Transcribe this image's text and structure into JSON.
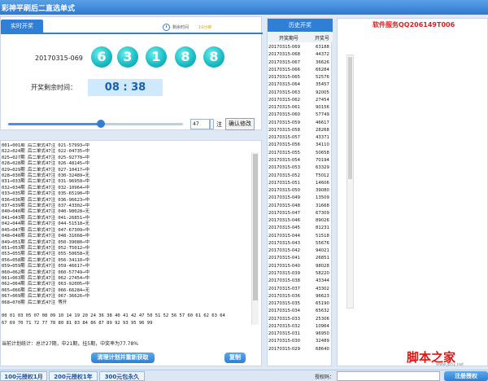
{
  "window": {
    "title": "彩神平刷后二直选单式"
  },
  "realtime": {
    "tab_label": "实时开奖",
    "remain_label": "剩余时间",
    "remain_value": "19分钟",
    "period": "20170315-069",
    "balls": [
      "6",
      "3",
      "1",
      "8",
      "8"
    ],
    "countdown_label": "开奖剩余时间：",
    "countdown": "08 : 38"
  },
  "controls": {
    "slider_fraction": 0.53,
    "count_value": "47",
    "unit": "注",
    "confirm_label": "确认修改"
  },
  "log": {
    "lines": [
      "001→001期 后二单式47注 021-57993→中",
      "022→024期 后二单式47注 022-04735→中",
      "025→027期 后二单式47注 025-92770→中",
      "028→028期 后二单式47注 026-48145→中",
      "029→029期 后二单式47注 027-10417→中",
      "028→030期 后二单式47注 030-32489→无",
      "031→033期 后二单式47注 031-96950→中",
      "032→034期 后二单式47注 032-10964→中",
      "033→035期 后二单式47注 035-65190→中",
      "036→036期 后二单式47注 036-96623→中",
      "037→039期 后二单式47注 037-43302→中",
      "040→040期 后二单式47注 040-98028→无",
      "041→043期 后二单式47注 041-26851→中",
      "042→044期 后二单式47注 044-51518→无",
      "045→047期 后二单式47注 047-67309→中",
      "048→048期 后二单式47注 048-31668→中",
      "049→051期 后二单式47注 050-39080→中",
      "051→053期 后二单式47注 052-T5012→中",
      "053→055期 后二单式47注 055-50658→无",
      "056→058期 后二单式47注 056-34110→中",
      "059→059期 后二单式47注 059-46617→中",
      "060→062期 后二单式47注 060-57749→中",
      "061→063期 后二单式47注 062-27454→中",
      "062→064期 后二单式47注 063-92005→中",
      "065→066期 后二单式47注 066-66284→无",
      "067→069期 后二单式47注 067-36626→中",
      "068→070期 后二单式47注 等开"
    ],
    "numbers_line1": "00 01 03 05 07 08 09 10 14 19 20 24 36 38 40 41 42 47 50 51 52 56 57 60 61 62 63 64",
    "numbers_line2": "67 69 70 71 72 77 78 80 81 83 84 86 87 89 92 93 95 96 99",
    "stats": "当前计划统计：总计27期，中21期，挂5期，中奖率为77.78%",
    "clear_btn": "清理计划并重新获取",
    "copy_btn": "复制"
  },
  "history": {
    "header": "历史开奖",
    "col_period": "开奖期号",
    "col_number": "开奖号",
    "rows": [
      [
        "20170315-069",
        "63188"
      ],
      [
        "20170315-068",
        "44372"
      ],
      [
        "20170315-067",
        "36626"
      ],
      [
        "20170315-066",
        "66284"
      ],
      [
        "20170315-065",
        "52576"
      ],
      [
        "20170315-064",
        "35457"
      ],
      [
        "20170315-063",
        "92005"
      ],
      [
        "20170315-062",
        "27454"
      ],
      [
        "20170315-061",
        "90156"
      ],
      [
        "20170315-060",
        "57749"
      ],
      [
        "20170315-059",
        "46617"
      ],
      [
        "20170315-058",
        "28268"
      ],
      [
        "20170315-057",
        "43371"
      ],
      [
        "20170315-056",
        "34110"
      ],
      [
        "20170315-055",
        "50658"
      ],
      [
        "20170315-054",
        "70194"
      ],
      [
        "20170315-053",
        "63329"
      ],
      [
        "20170315-052",
        "T5012"
      ],
      [
        "20170315-051",
        "14606"
      ],
      [
        "20170315-050",
        "39080"
      ],
      [
        "20170315-049",
        "13509"
      ],
      [
        "20170315-048",
        "31668"
      ],
      [
        "20170315-047",
        "67309"
      ],
      [
        "20170315-046",
        "89026"
      ],
      [
        "20170315-045",
        "81231"
      ],
      [
        "20170315-044",
        "51518"
      ],
      [
        "20170315-043",
        "55676"
      ],
      [
        "20170315-042",
        "94021"
      ],
      [
        "20170315-041",
        "26851"
      ],
      [
        "20170315-040",
        "98028"
      ],
      [
        "20170315-039",
        "58220"
      ],
      [
        "20170315-038",
        "43344"
      ],
      [
        "20170315-037",
        "43302"
      ],
      [
        "20170315-036",
        "96623"
      ],
      [
        "20170315-035",
        "65190"
      ],
      [
        "20170315-034",
        "65632"
      ],
      [
        "20170315-033",
        "25306"
      ],
      [
        "20170315-032",
        "10964"
      ],
      [
        "20170315-031",
        "96950"
      ],
      [
        "20170315-030",
        "32489"
      ],
      [
        "20170315-029",
        "68640"
      ]
    ]
  },
  "service": {
    "label": "软件服务QQ206149T006"
  },
  "bottom": {
    "plans": [
      "100元授权1月",
      "200元授权1年",
      "300元包永久"
    ],
    "auth_label": "授权码：",
    "register_btn": "注册授权"
  },
  "watermark": {
    "text": "脚本之家",
    "sub": "www.jb51.net"
  }
}
